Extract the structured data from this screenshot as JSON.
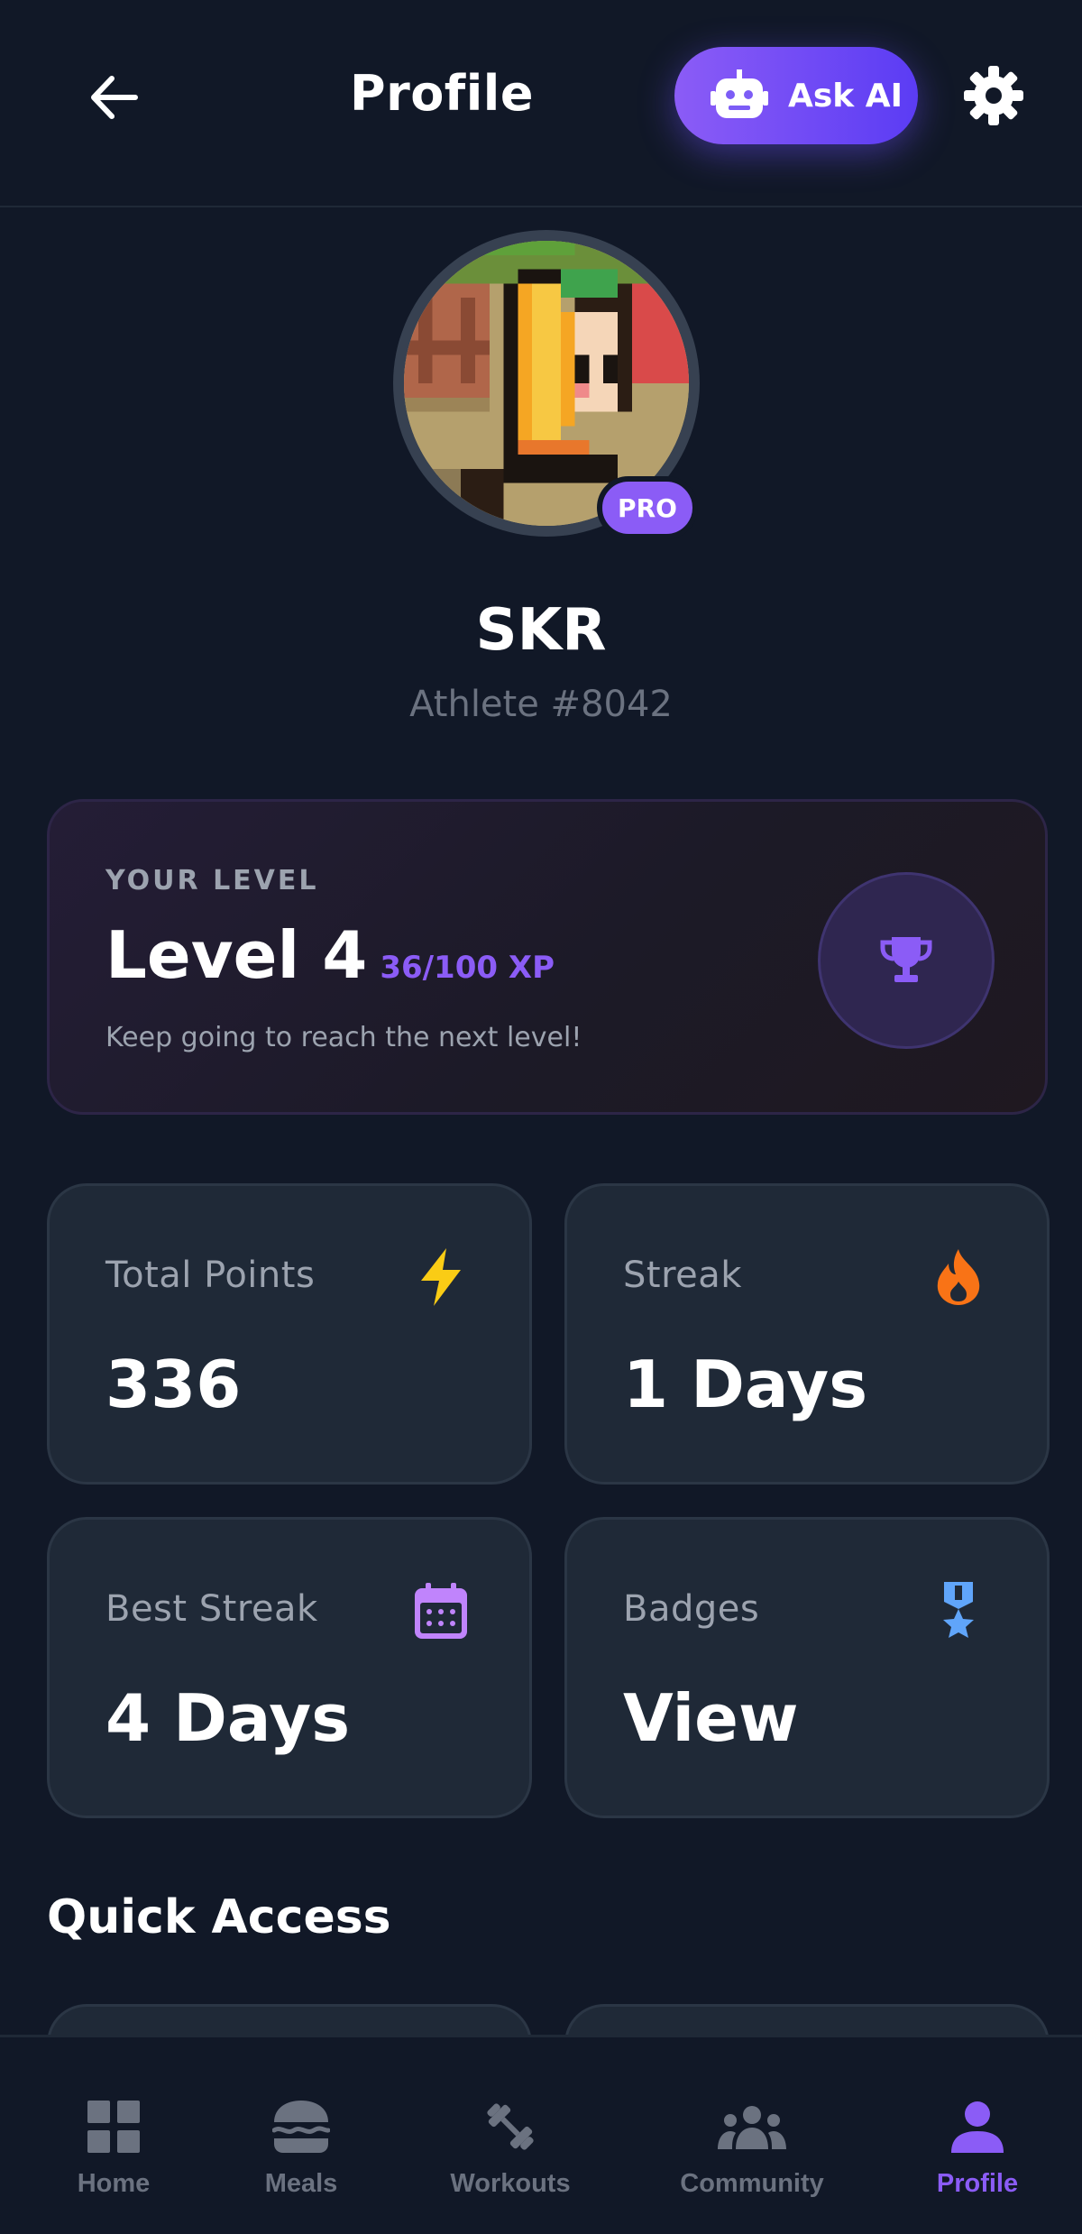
{
  "header": {
    "title": "Profile",
    "ask_ai_label": "Ask AI"
  },
  "profile": {
    "badge": "PRO",
    "username": "SKR",
    "athlete_id": "Athlete #8042"
  },
  "level": {
    "label": "YOUR LEVEL",
    "title": "Level 4",
    "xp": "36/100 XP",
    "hint": "Keep going to reach the next level!"
  },
  "stats": [
    {
      "label": "Total Points",
      "value": "336",
      "icon": "lightning-icon",
      "color": "#facc15"
    },
    {
      "label": "Streak",
      "value": "1 Days",
      "icon": "flame-icon",
      "color": "#f97316"
    },
    {
      "label": "Best Streak",
      "value": "4 Days",
      "icon": "calendar-icon",
      "color": "#c084fc"
    },
    {
      "label": "Badges",
      "value": "View",
      "icon": "medal-icon",
      "color": "#60a5fa"
    }
  ],
  "quick_access": {
    "title": "Quick Access"
  },
  "nav": [
    {
      "label": "Home",
      "icon": "grid-icon"
    },
    {
      "label": "Meals",
      "icon": "burger-icon"
    },
    {
      "label": "Workouts",
      "icon": "dumbbell-icon"
    },
    {
      "label": "Community",
      "icon": "people-icon"
    },
    {
      "label": "Profile",
      "icon": "person-icon",
      "active": true
    }
  ],
  "colors": {
    "background": "#111827",
    "card": "#1f2937",
    "accent": "#8b5cf6",
    "muted": "#9ca3af"
  }
}
